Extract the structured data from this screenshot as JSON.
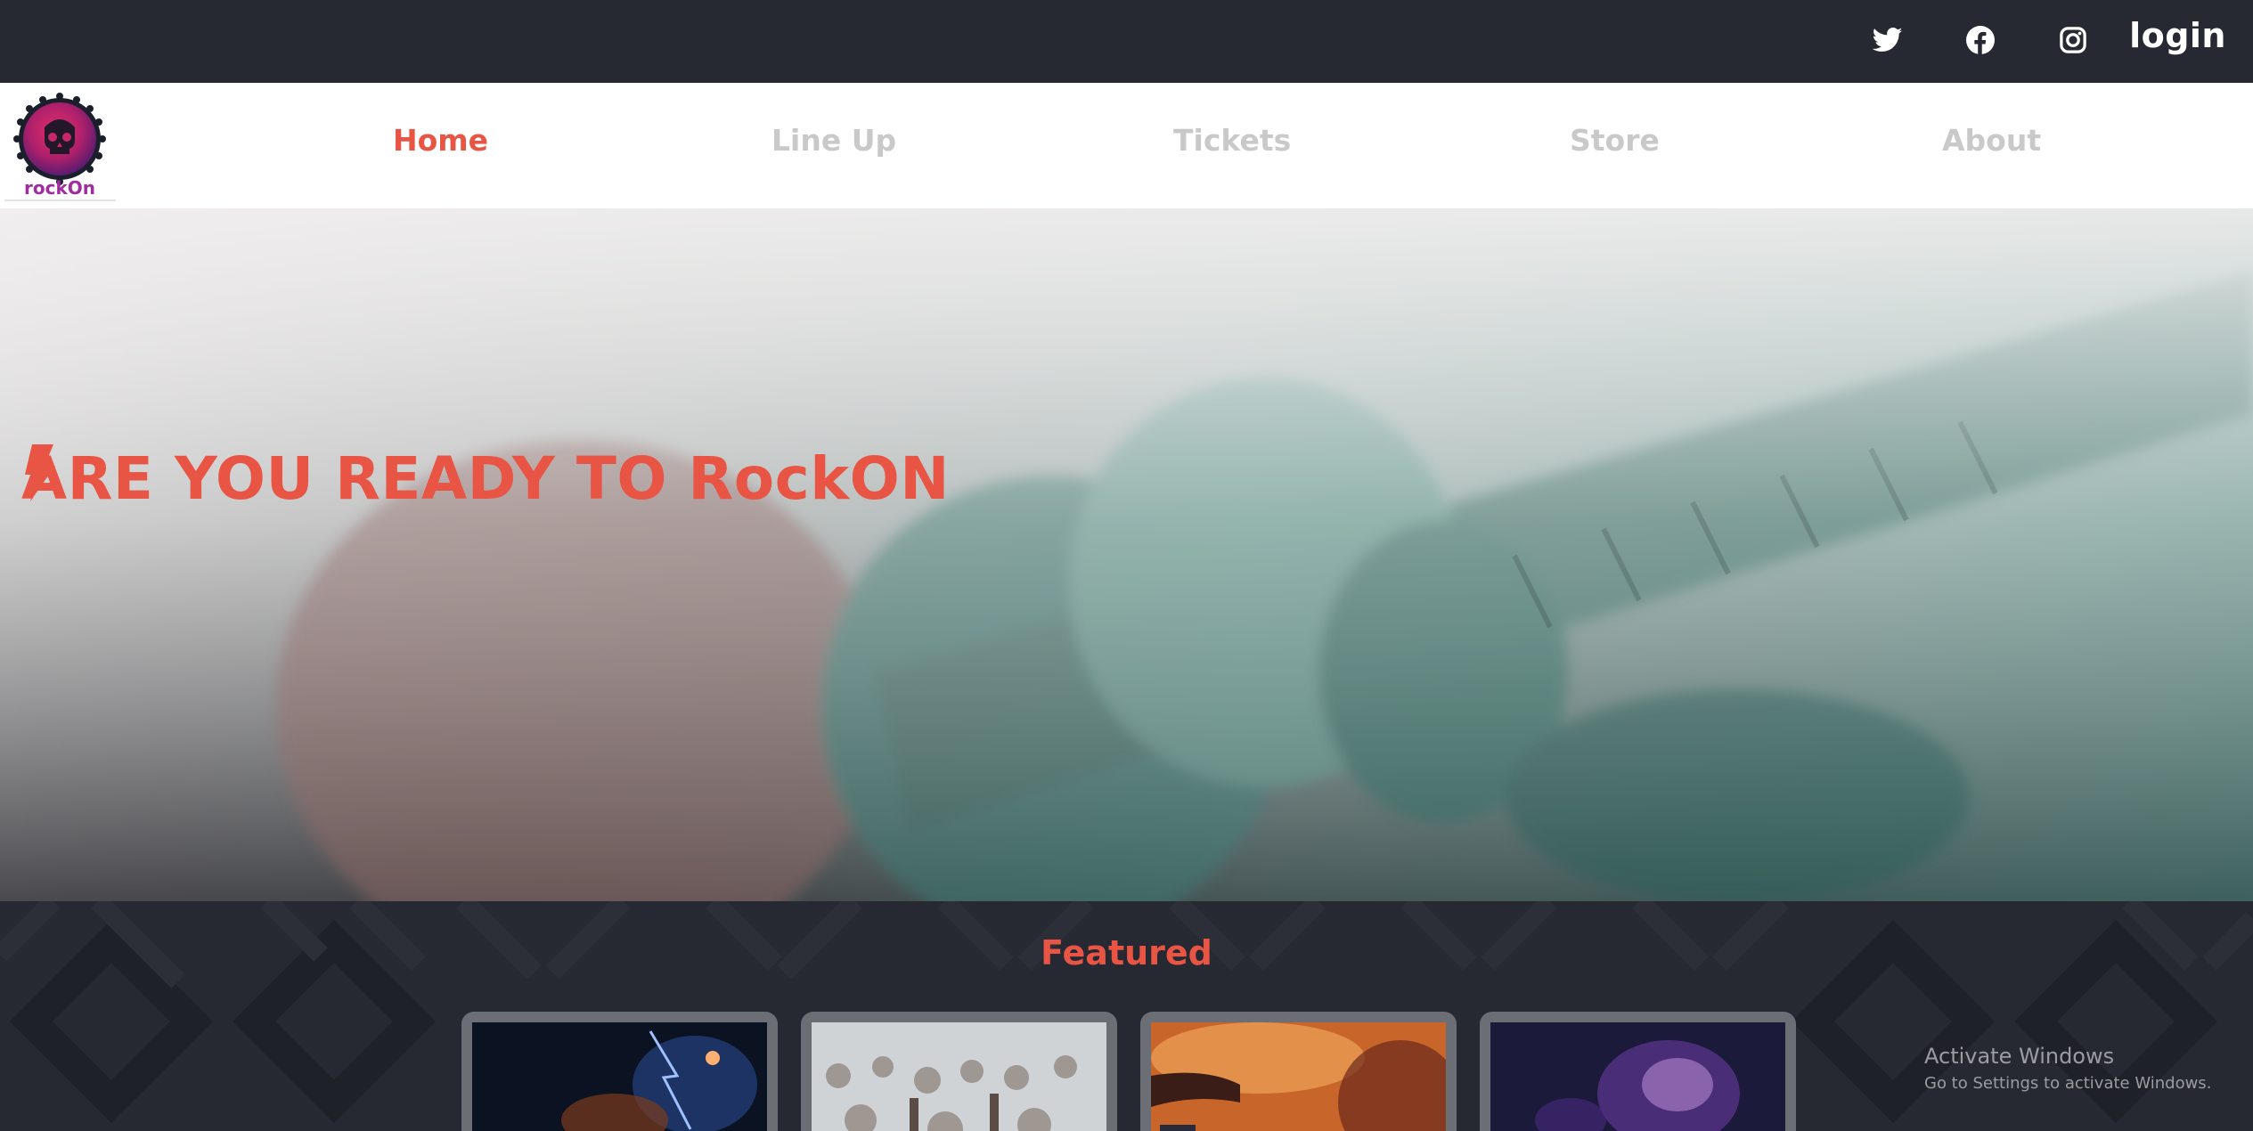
{
  "topbar": {
    "social": [
      {
        "icon": "twitter-icon"
      },
      {
        "icon": "facebook-icon"
      },
      {
        "icon": "instagram-icon"
      }
    ],
    "login_label": "login"
  },
  "logo": {
    "text": "rockOn"
  },
  "nav": {
    "items": [
      {
        "label": "Home",
        "active": true
      },
      {
        "label": "Line Up",
        "active": false
      },
      {
        "label": "Tickets",
        "active": false
      },
      {
        "label": "Store",
        "active": false
      },
      {
        "label": "About",
        "active": false
      }
    ]
  },
  "hero": {
    "title": "ARE YOU READY TO RockON",
    "icon": "lightning-bolt-icon"
  },
  "featured": {
    "title": "Featured",
    "cards": [
      {
        "image": "concert-stage-lights"
      },
      {
        "image": "festival-crowd"
      },
      {
        "image": "guitarist-orange-lights"
      },
      {
        "image": "purple-smoke-stage"
      }
    ]
  },
  "watermark": {
    "line1": "Activate Windows",
    "line2": "Go to Settings to activate Windows."
  },
  "colors": {
    "accent": "#e85545",
    "topbar": "#262932",
    "nav_inactive": "#c9c9c9"
  }
}
